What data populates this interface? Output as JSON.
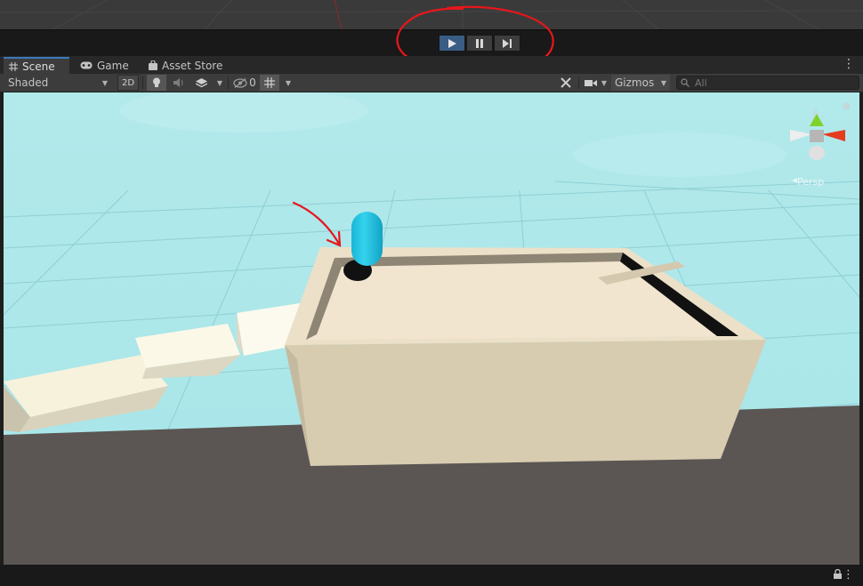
{
  "play_controls": {
    "play_label": "play",
    "pause_label": "pause",
    "step_label": "step"
  },
  "tabs": [
    {
      "label": "Scene",
      "icon": "grid-icon",
      "active": true
    },
    {
      "label": "Game",
      "icon": "gamepad-icon",
      "active": false
    },
    {
      "label": "Asset Store",
      "icon": "shopping-bag-icon",
      "active": false
    }
  ],
  "toolbar": {
    "draw_mode": "Shaded",
    "mode_2d": "2D",
    "hidden_count": "0",
    "gizmos_label": "Gizmos",
    "search_placeholder": "All"
  },
  "scene_gizmo": {
    "projection_label": "Persp"
  },
  "colors": {
    "accent_blue": "#395d84",
    "tab_highlight": "#3a79bb",
    "sky": "#a9e6e8",
    "ground": "#5b5653",
    "capsule": "#26c6e4",
    "annotation_red": "#e8161c"
  }
}
